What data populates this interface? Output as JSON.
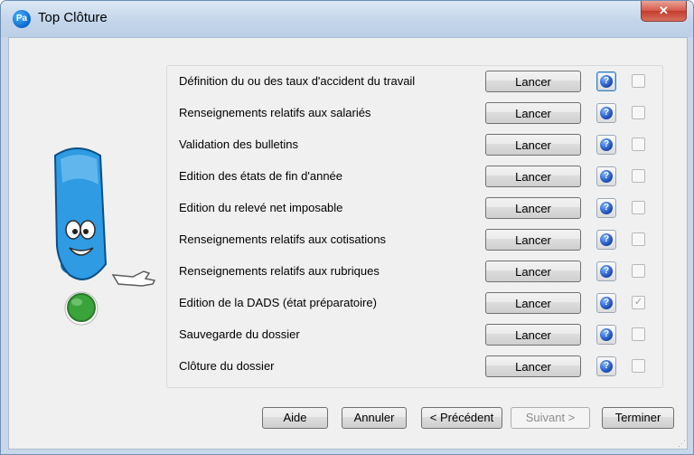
{
  "window": {
    "title": "Top Clôture",
    "app_icon_text": "Pa",
    "close_glyph": "✕"
  },
  "tasks": [
    {
      "label": "Définition du ou des taux d'accident du travail",
      "button": "Lancer",
      "checked": false,
      "help_focused": true
    },
    {
      "label": "Renseignements relatifs aux salariés",
      "button": "Lancer",
      "checked": false
    },
    {
      "label": "Validation des bulletins",
      "button": "Lancer",
      "checked": false
    },
    {
      "label": "Edition des états de fin d'année",
      "button": "Lancer",
      "checked": false
    },
    {
      "label": "Edition du relevé net imposable",
      "button": "Lancer",
      "checked": false
    },
    {
      "label": "Renseignements relatifs aux cotisations",
      "button": "Lancer",
      "checked": false
    },
    {
      "label": "Renseignements relatifs aux rubriques",
      "button": "Lancer",
      "checked": false
    },
    {
      "label": "Edition de la DADS (état préparatoire)",
      "button": "Lancer",
      "checked": true
    },
    {
      "label": "Sauvegarde du dossier",
      "button": "Lancer",
      "checked": false
    },
    {
      "label": "Clôture du dossier",
      "button": "Lancer",
      "checked": false
    }
  ],
  "help_glyph": "?",
  "check_glyph": "✓",
  "footer": {
    "aide": "Aide",
    "annuler": "Annuler",
    "precedent": "< Précédent",
    "suivant": "Suivant >",
    "terminer": "Terminer"
  },
  "colors": {
    "title_bar": "#c3d5ea",
    "close_button": "#c43b2d",
    "help_icon": "#1d4fb8",
    "mascot_body": "#2e9be3",
    "status_light": "#3aa43a"
  }
}
